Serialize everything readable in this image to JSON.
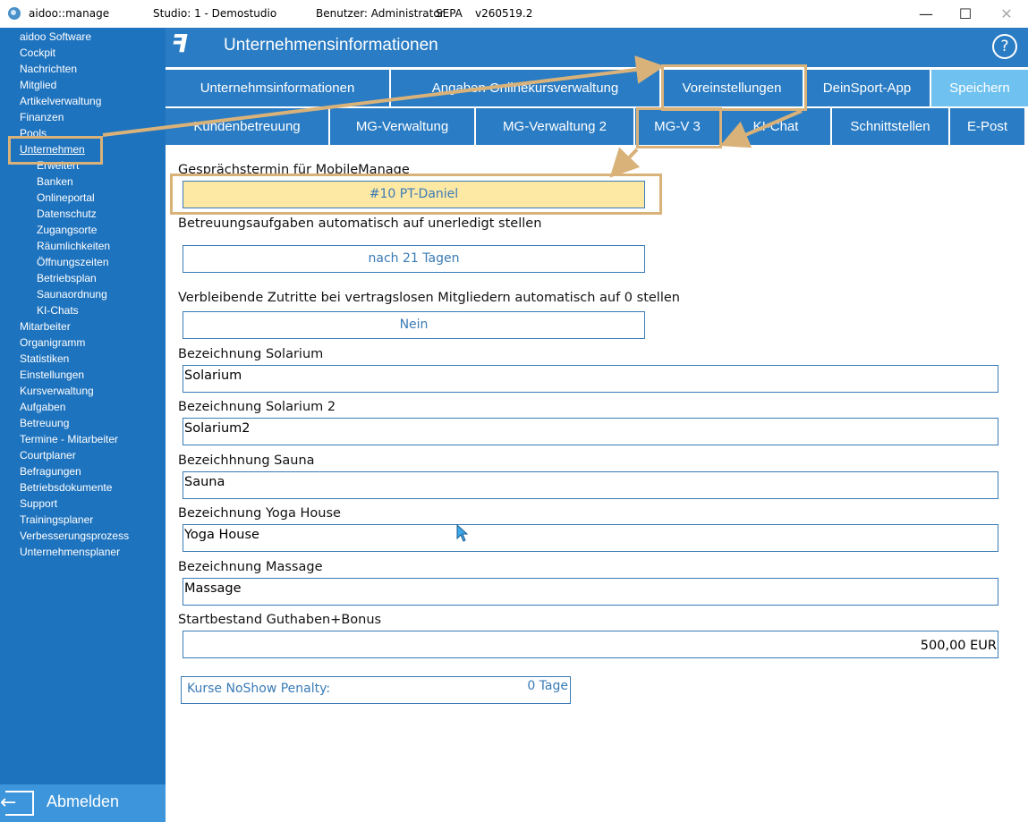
{
  "titlebar": {
    "app_name": "aidoo::manage",
    "studio": "Studio: 1 - Demostudio",
    "user": "Benutzer: Administrator",
    "sepa": "SEPA",
    "version": "v260519.2",
    "minimize": "—",
    "maximize": "☐",
    "close": "✕"
  },
  "sidebar": {
    "items": [
      {
        "label": "aidoo Software",
        "sub": false
      },
      {
        "label": "Cockpit",
        "sub": false
      },
      {
        "label": "Nachrichten",
        "sub": false
      },
      {
        "label": "Mitglied",
        "sub": false
      },
      {
        "label": "Artikelverwaltung",
        "sub": false
      },
      {
        "label": "Finanzen",
        "sub": false
      },
      {
        "label": "Pools",
        "sub": false
      },
      {
        "label": "Unternehmen",
        "sub": false,
        "active": true
      },
      {
        "label": "Erweitert",
        "sub": true
      },
      {
        "label": "Banken",
        "sub": true
      },
      {
        "label": "Onlineportal",
        "sub": true
      },
      {
        "label": "Datenschutz",
        "sub": true
      },
      {
        "label": "Zugangsorte",
        "sub": true
      },
      {
        "label": "Räumlichkeiten",
        "sub": true
      },
      {
        "label": "Öffnungszeiten",
        "sub": true
      },
      {
        "label": "Betriebsplan",
        "sub": true
      },
      {
        "label": "Saunaordnung",
        "sub": true
      },
      {
        "label": "KI-Chats",
        "sub": true
      },
      {
        "label": "Mitarbeiter",
        "sub": false
      },
      {
        "label": "Organigramm",
        "sub": false
      },
      {
        "label": "Statistiken",
        "sub": false
      },
      {
        "label": "Einstellungen",
        "sub": false
      },
      {
        "label": "Kursverwaltung",
        "sub": false
      },
      {
        "label": "Aufgaben",
        "sub": false
      },
      {
        "label": "Betreuung",
        "sub": false
      },
      {
        "label": "Termine - Mitarbeiter",
        "sub": false
      },
      {
        "label": "Courtplaner",
        "sub": false
      },
      {
        "label": "Befragungen",
        "sub": false
      },
      {
        "label": "Betriebsdokumente",
        "sub": false
      },
      {
        "label": "Support",
        "sub": false
      },
      {
        "label": "Trainingsplaner",
        "sub": false
      },
      {
        "label": "Verbesserungsprozess",
        "sub": false
      },
      {
        "label": "Unternehmensplaner",
        "sub": false
      }
    ],
    "logout_label": "Abmelden"
  },
  "header": {
    "title": "Unternehmensinformationen",
    "help": "?"
  },
  "tabs_row1": [
    {
      "label": "Unternehmsinformationen"
    },
    {
      "label": "Angaben Onlinekursverwaltung"
    },
    {
      "label": "Voreinstellungen"
    },
    {
      "label": "DeinSport-App"
    },
    {
      "label": "Speichern"
    }
  ],
  "tabs_row2": [
    {
      "label": "Kundenbetreuung"
    },
    {
      "label": "MG-Verwaltung"
    },
    {
      "label": "MG-Verwaltung 2"
    },
    {
      "label": "MG-V 3"
    },
    {
      "label": "KI-Chat"
    },
    {
      "label": "Schnittstellen"
    },
    {
      "label": "E-Post"
    }
  ],
  "form": {
    "gespraech_label": "Gesprächstermin für MobileManage",
    "gespraech_value": "#10 PT-Daniel",
    "betreuung_label": "Betreuungsaufgaben automatisch auf unerledigt stellen",
    "betreuung_value": "nach 21 Tagen",
    "zutritte_label": "Verbleibende Zutritte bei vertragslosen Mitgliedern automatisch auf 0 stellen",
    "zutritte_value": "Nein",
    "solarium_label": "Bezeichnung Solarium",
    "solarium_value": "Solarium",
    "solarium2_label": "Bezeichnung Solarium 2",
    "solarium2_value": "Solarium2",
    "sauna_label": "Bezeichhnung Sauna",
    "sauna_value": "Sauna",
    "yoga_label": "Bezeichnung Yoga House",
    "yoga_value": "Yoga House",
    "massage_label": "Bezeichnung Massage",
    "massage_value": "Massage",
    "guthaben_label": "Startbestand Guthaben+Bonus",
    "guthaben_value": "500,00 EUR",
    "penalty_label": "Kurse NoShow Penalty:",
    "penalty_value": "0 Tage"
  },
  "colors": {
    "sidebar": "#1e73be",
    "tab": "#2a7cc4",
    "save_tab": "#6fc2f0",
    "annotation": "#d9b27a",
    "highlight_field": "#fde8a4"
  }
}
